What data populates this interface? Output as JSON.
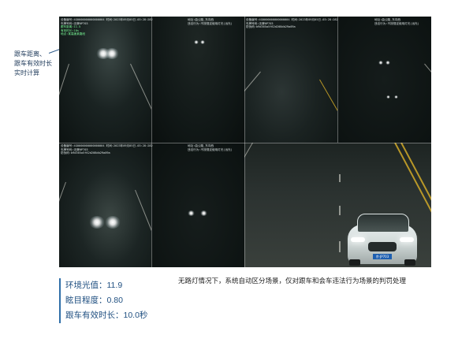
{
  "callout": {
    "line1": "跟车距离、",
    "line2": "跟车有效时长",
    "line3": "实时计算"
  },
  "overlays": {
    "tl": {
      "l1": "设备编号:4G0000000000000004   时间:2023年09月05日-03:28:282",
      "l2": "车牌号码:无牌0P703",
      "l3": "跟车距离:11.5",
      "l4": "有效时长:10s",
      "l5": "地点:某高速某路段",
      "r1": "地址:曲公路_东向西",
      "r2": "违法行为:不按规定使用灯光(远光)"
    },
    "tr": {
      "l1": "设备编号:4G0000000000000004   时间:2023年09月05日-03:28:282",
      "l2": "车牌号码:无牌0P703",
      "l3": "防伪码:b9d365a5f62d208db29a09a",
      "r1": "地址:曲公路_东向西",
      "r2": "违法行为:不按规定使用灯光(远光)"
    },
    "bl": {
      "l1": "设备编号:4G0000000000000004   时间:2023年09月05日-03:28:282",
      "l2": "车牌号码:无牌0P703",
      "l3": "防伪码:b9d365a5f62d208db29a09a",
      "r1": "地址:曲公路_东向西",
      "r2": "违法行为:不按规定使用灯光(远光)"
    },
    "plate": "京·JP703"
  },
  "metrics": {
    "ambient": "环境光值：11.9",
    "glare": "眩目程度：0.80",
    "duration": "跟车有效时长：10.0秒"
  },
  "caption": "无路灯情况下，系统自动区分场景，仅对跟车和会车违法行为场景的判罚处理"
}
